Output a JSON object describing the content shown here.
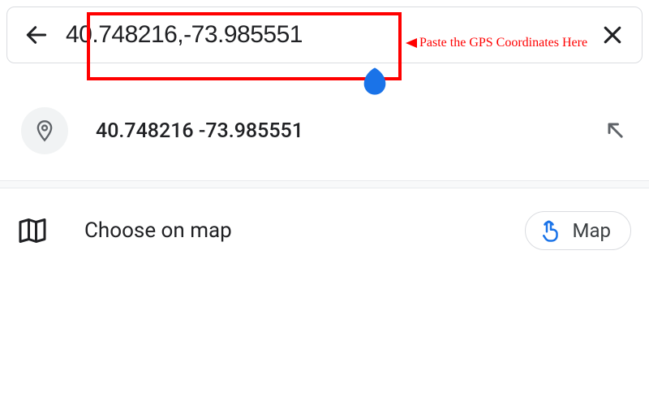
{
  "search": {
    "value": "40.748216,-73.985551"
  },
  "annotation": {
    "text": "Paste the GPS Coordinates Here"
  },
  "suggestion": {
    "text": "40.748216 -73.985551"
  },
  "chooseOnMap": {
    "label": "Choose on map",
    "buttonLabel": "Map"
  }
}
